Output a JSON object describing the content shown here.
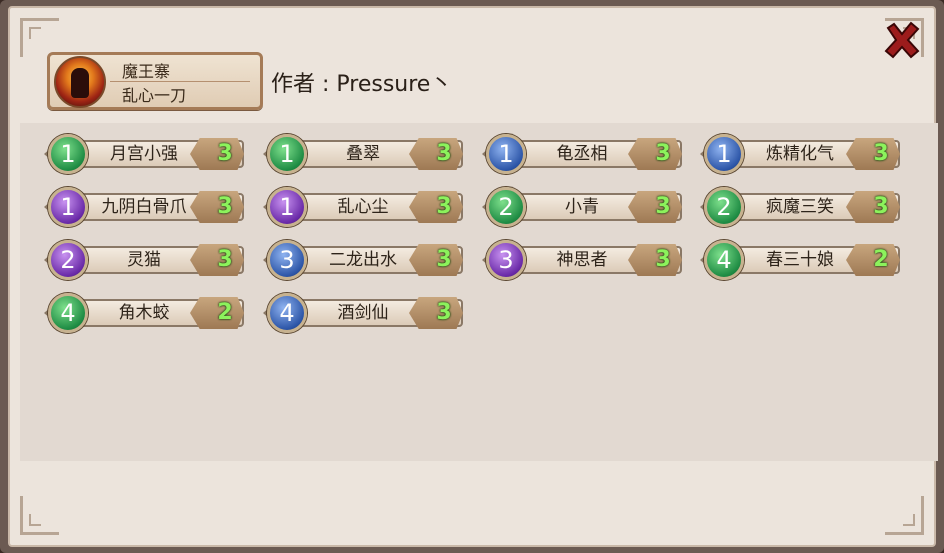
{
  "header": {
    "team_name": "魔王寨",
    "team_sub": "乱心一刀",
    "author": "作者 : Pressure丶"
  },
  "colors": {
    "badge_green": "#1f8c44",
    "badge_blue": "#2d56a8",
    "badge_purple": "#6a2aa8",
    "count_text": "#8cf25c"
  },
  "cards": [
    {
      "level": "1",
      "name": "月宫小强",
      "count": "3",
      "badge": "green"
    },
    {
      "level": "1",
      "name": "叠翠",
      "count": "3",
      "badge": "green"
    },
    {
      "level": "1",
      "name": "龟丞相",
      "count": "3",
      "badge": "blue"
    },
    {
      "level": "1",
      "name": "炼精化气",
      "count": "3",
      "badge": "blue"
    },
    {
      "level": "1",
      "name": "九阴白骨爪",
      "count": "3",
      "badge": "purple"
    },
    {
      "level": "1",
      "name": "乱心尘",
      "count": "3",
      "badge": "purple"
    },
    {
      "level": "2",
      "name": "小青",
      "count": "3",
      "badge": "green"
    },
    {
      "level": "2",
      "name": "疯魔三笑",
      "count": "3",
      "badge": "green"
    },
    {
      "level": "2",
      "name": "灵猫",
      "count": "3",
      "badge": "purple"
    },
    {
      "level": "3",
      "name": "二龙出水",
      "count": "3",
      "badge": "blue"
    },
    {
      "level": "3",
      "name": "神思者",
      "count": "3",
      "badge": "purple"
    },
    {
      "level": "4",
      "name": "春三十娘",
      "count": "2",
      "badge": "green"
    },
    {
      "level": "4",
      "name": "角木蛟",
      "count": "2",
      "badge": "green"
    },
    {
      "level": "4",
      "name": "酒剑仙",
      "count": "3",
      "badge": "blue"
    }
  ],
  "icons": {
    "close": "close-icon",
    "avatar": "avatar-portrait"
  }
}
